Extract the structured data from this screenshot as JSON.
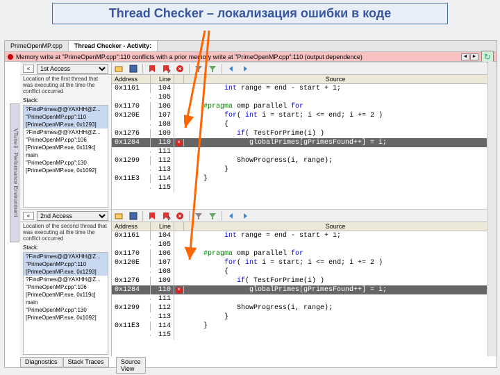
{
  "title": "Thread Checker – локализация ошибки в коде",
  "tabs": {
    "file": "PrimeOpenMP.cpp",
    "active": "Thread Checker - Activity:"
  },
  "error_bar": "Memory write at \"PrimeOpenMP.cpp\":110 conflicts with a prior memory write at \"PrimeOpenMP.cpp\":110 (output dependence)",
  "side_label": "VTune™ Performance Environment",
  "access": {
    "first": {
      "label": "1st Access",
      "desc": "Location of the first thread that was executing at the time the conflict occurred",
      "stack_label": "Stack:",
      "stack": [
        "?FindPrimes@@YAXHH@Z...",
        "\"PrimeOpenMP.cpp\":110",
        "[PrimeOpenMP.exe, 0x1293]",
        "?FindPrimes@@YAXHH@Z...",
        "\"PrimeOpenMP.cpp\":106",
        "[PrimeOpenMP.exe, 0x119c]",
        "main",
        "\"PrimeOpenMP.cpp\":130",
        "[PrimeOpenMP.exe, 0x1092]"
      ]
    },
    "second": {
      "label": "2nd Access",
      "desc": "Location of the second thread that was executing at the time the conflict occurred",
      "stack_label": "Stack:",
      "stack": [
        "?FindPrimes@@YAXHH@Z...",
        "\"PrimeOpenMP.cpp\":110",
        "[PrimeOpenMP.exe, 0x1293]",
        "?FindPrimes@@YAXHH@Z...",
        "\"PrimeOpenMP.cpp\":106",
        "[PrimeOpenMP.exe, 0x119c]",
        "main",
        "\"PrimeOpenMP.cpp\":130",
        "[PrimeOpenMP.exe, 0x1092]"
      ]
    }
  },
  "src_headers": {
    "addr": "Address",
    "line": "Line",
    "src": "Source"
  },
  "source_rows": [
    {
      "addr": "0x1161",
      "line": "104",
      "mark": "",
      "html": "         <span class='kw-blue'>int</span> range = end - start + 1;"
    },
    {
      "addr": "",
      "line": "105",
      "mark": "",
      "html": ""
    },
    {
      "addr": "0x1170",
      "line": "106",
      "mark": "",
      "html": "    <span class='kw-green'>#pragma</span> omp parallel <span class='kw-blue'>for</span>"
    },
    {
      "addr": "0x120E",
      "line": "107",
      "mark": "",
      "html": "         <span class='kw-blue'>for</span>( <span class='kw-blue'>int</span> i = start; i &lt;= end; i += 2 )"
    },
    {
      "addr": "",
      "line": "108",
      "mark": "",
      "html": "         {"
    },
    {
      "addr": "0x1276",
      "line": "109",
      "mark": "",
      "html": "            <span class='kw-blue'>if</span>( TestForPrime(i) )"
    },
    {
      "addr": "0x1284",
      "line": "110",
      "mark": "err",
      "hl": true,
      "html": "               globalPrimes[gPrimesFound++] = i;"
    },
    {
      "addr": "",
      "line": "111",
      "mark": "",
      "html": ""
    },
    {
      "addr": "0x1299",
      "line": "112",
      "mark": "",
      "html": "            ShowProgress(i, range);"
    },
    {
      "addr": "",
      "line": "113",
      "mark": "",
      "html": "         }"
    },
    {
      "addr": "0x11E3",
      "line": "114",
      "mark": "",
      "html": "    }"
    },
    {
      "addr": "",
      "line": "115",
      "mark": "",
      "html": ""
    }
  ],
  "bottom_tabs": {
    "left": [
      "Diagnostics",
      "Stack Traces"
    ],
    "right": "Source View"
  }
}
